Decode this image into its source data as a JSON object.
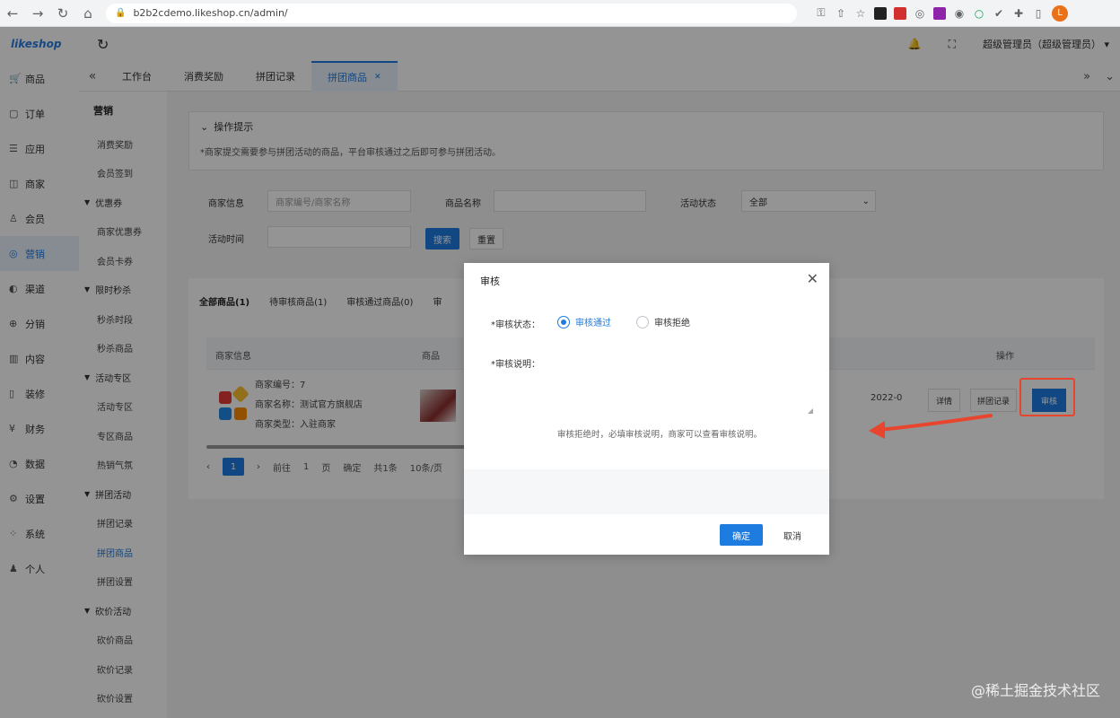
{
  "browser": {
    "url": "b2b2cdemo.likeshop.cn/admin/",
    "profile_initial": "L"
  },
  "header": {
    "logo": "likeshop",
    "user": "超级管理员（超级管理员）"
  },
  "sidebar": {
    "items": [
      {
        "label": "商品",
        "icon": "cart-icon"
      },
      {
        "label": "订单",
        "icon": "order-icon"
      },
      {
        "label": "应用",
        "icon": "app-icon"
      },
      {
        "label": "商家",
        "icon": "shop-icon"
      },
      {
        "label": "会员",
        "icon": "user-icon"
      },
      {
        "label": "营销",
        "icon": "marketing-icon",
        "active": true
      },
      {
        "label": "渠道",
        "icon": "channel-icon"
      },
      {
        "label": "分销",
        "icon": "distribution-icon"
      },
      {
        "label": "内容",
        "icon": "content-icon"
      },
      {
        "label": "装修",
        "icon": "decorate-icon"
      },
      {
        "label": "财务",
        "icon": "finance-icon"
      },
      {
        "label": "数据",
        "icon": "data-icon"
      },
      {
        "label": "设置",
        "icon": "settings-icon"
      },
      {
        "label": "系统",
        "icon": "system-icon"
      },
      {
        "label": "个人",
        "icon": "person-icon"
      }
    ]
  },
  "subnav": {
    "title": "营销",
    "entries": [
      {
        "type": "item",
        "label": "消费奖励"
      },
      {
        "type": "item",
        "label": "会员签到"
      },
      {
        "type": "group",
        "label": "优惠券"
      },
      {
        "type": "item",
        "label": "商家优惠券"
      },
      {
        "type": "item",
        "label": "会员卡券"
      },
      {
        "type": "group",
        "label": "限时秒杀"
      },
      {
        "type": "item",
        "label": "秒杀时段"
      },
      {
        "type": "item",
        "label": "秒杀商品"
      },
      {
        "type": "group",
        "label": "活动专区"
      },
      {
        "type": "item",
        "label": "活动专区"
      },
      {
        "type": "item",
        "label": "专区商品"
      },
      {
        "type": "item",
        "label": "热销气氛"
      },
      {
        "type": "group",
        "label": "拼团活动"
      },
      {
        "type": "item",
        "label": "拼团记录"
      },
      {
        "type": "item",
        "label": "拼团商品",
        "active": true
      },
      {
        "type": "item",
        "label": "拼团设置"
      },
      {
        "type": "group",
        "label": "砍价活动"
      },
      {
        "type": "item",
        "label": "砍价商品"
      },
      {
        "type": "item",
        "label": "砍价记录"
      },
      {
        "type": "item",
        "label": "砍价设置"
      }
    ]
  },
  "tabs": {
    "items": [
      {
        "label": "工作台"
      },
      {
        "label": "消费奖励"
      },
      {
        "label": "拼团记录"
      },
      {
        "label": "拼团商品",
        "active": true
      }
    ]
  },
  "content": {
    "tips_title": "操作提示",
    "tips_body": "*商家提交需要参与拼团活动的商品，平台审核通过之后即可参与拼团活动。",
    "filters": {
      "shop_label": "商家信息",
      "shop_placeholder": "商家编号/商家名称",
      "goods_label": "商品名称",
      "status_label": "活动状态",
      "status_value": "全部",
      "time_label": "活动时间",
      "search_btn": "搜索",
      "reset_btn": "重置"
    },
    "list_tabs": [
      "全部商品(1)",
      "待审核商品(1)",
      "审核通过商品(0)",
      "审"
    ],
    "columns": {
      "shop": "商家信息",
      "goods": "商品",
      "op": "操作"
    },
    "row": {
      "shop_no": "商家编号：7",
      "shop_name": "商家名称：测试官方旗舰店",
      "shop_type": "商家类型：入驻商家",
      "date": "2022-0",
      "op_detail": "详情",
      "op_record": "拼团记录",
      "op_audit": "审核"
    },
    "pager": {
      "prev": "‹",
      "current": "1",
      "next": "›",
      "goto": "前往",
      "page_input": "1",
      "page_unit": "页",
      "confirm": "确定",
      "total": "共1条",
      "size": "10条/页"
    }
  },
  "modal": {
    "title": "审核",
    "status_label": "*审核状态：",
    "options": [
      {
        "label": "审核通过",
        "checked": true
      },
      {
        "label": "审核拒绝",
        "checked": false
      }
    ],
    "desc_label": "*审核说明：",
    "hint": "审核拒绝时，必填审核说明，商家可以查看审核说明。",
    "confirm": "确定",
    "cancel": "取消"
  },
  "watermark": "@稀土掘金技术社区",
  "colors": {
    "primary": "#1e7be0",
    "annotation": "#e8452e"
  }
}
